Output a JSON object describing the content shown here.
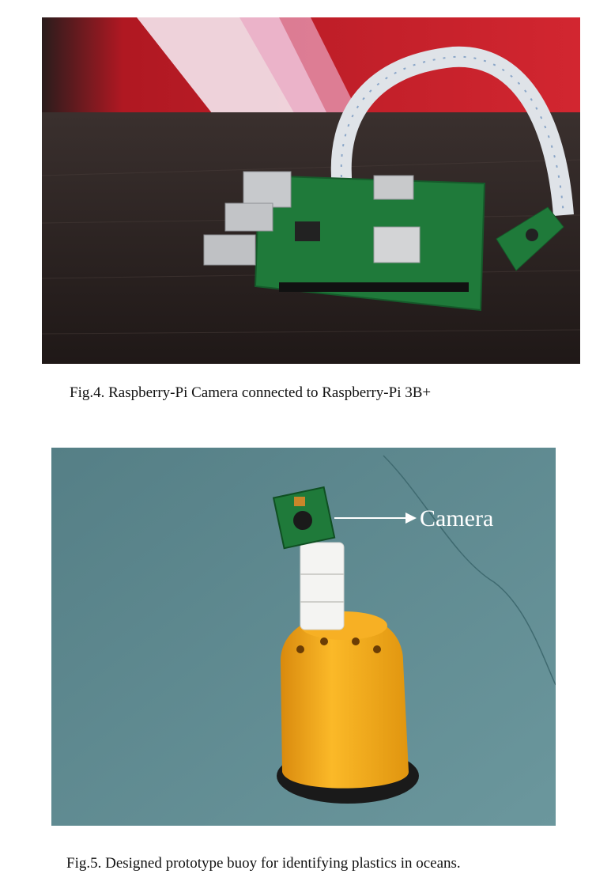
{
  "figures": [
    {
      "id": "fig4",
      "caption": "Fig.4. Raspberry-Pi Camera connected to Raspberry-Pi 3B+"
    },
    {
      "id": "fig5",
      "caption": "Fig.5. Designed prototype buoy for identifying plastics in oceans.",
      "annotation": "Camera"
    }
  ],
  "colors": {
    "wall_red": "#c81e28",
    "table_dark": "#2b2322",
    "pcb_green": "#1f7a3a",
    "ribbon": "#dfe3e8",
    "background_teal": "#5f8c92",
    "buoy_orange": "#f5a81c",
    "tube_white": "#f4f4f2"
  }
}
